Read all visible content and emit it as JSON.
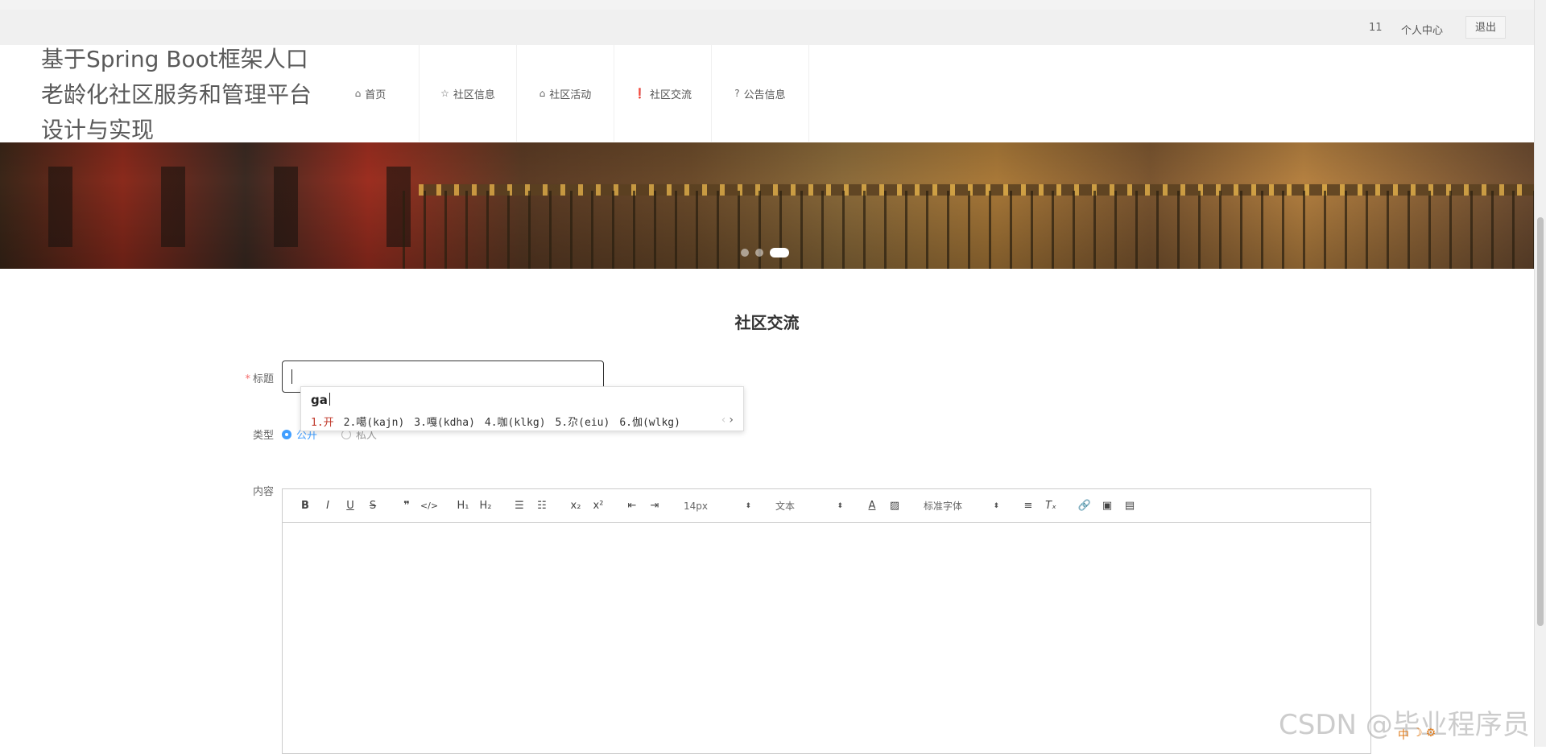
{
  "topbar": {
    "user_id": "11",
    "user_center": "个人中心",
    "logout": "退出"
  },
  "site": {
    "title": "基于Spring Boot框架人口老龄化社区服务和管理平台设计与实现"
  },
  "nav": [
    {
      "label": "首页",
      "icon": "home-icon",
      "glyph": "⌂"
    },
    {
      "label": "社区信息",
      "icon": "star-icon",
      "glyph": "☆"
    },
    {
      "label": "社区活动",
      "icon": "bag-icon",
      "glyph": "⌂"
    },
    {
      "label": "社区交流",
      "icon": "exclamation-circle-icon",
      "glyph": "❗"
    },
    {
      "label": "公告信息",
      "icon": "question-circle-icon",
      "glyph": "?"
    }
  ],
  "banner": {
    "active_slide": 3,
    "slide_count": 3
  },
  "page": {
    "title": "社区交流"
  },
  "form": {
    "title_label": "标题",
    "title_value": "",
    "type_label": "类型",
    "type_options": [
      "公开",
      "私人"
    ],
    "type_selected": "公开",
    "content_label": "内容"
  },
  "ime": {
    "pinyin": "ga",
    "candidates": [
      "1.开",
      "2.噶(kajn)",
      "3.嘎(kdha)",
      "4.咖(klkg)",
      "5.尕(eiu)",
      "6.伽(wlkg)"
    ]
  },
  "editor": {
    "font_size": "14px",
    "block_format": "文本",
    "font_family": "标准字体"
  },
  "watermark": "CSDN @毕业程序员",
  "tray": "中"
}
